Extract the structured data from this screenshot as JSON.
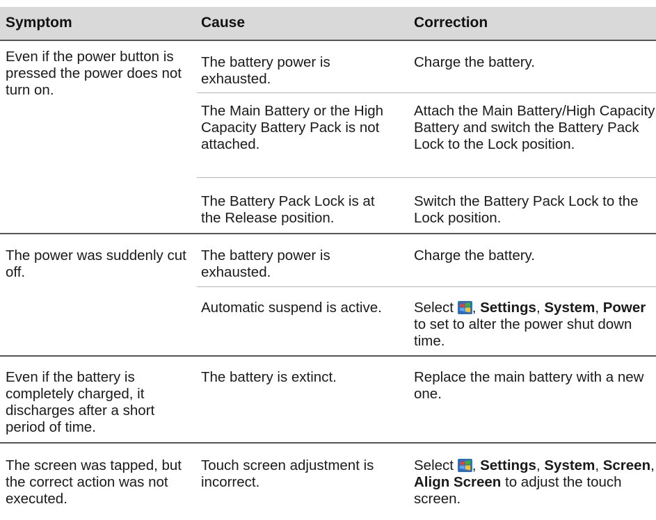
{
  "table": {
    "headers": {
      "symptom": "Symptom",
      "cause": "Cause",
      "correction": "Correction"
    },
    "groups": [
      {
        "symptom": "Even if the power button is pressed the power does not turn on.",
        "rows": [
          {
            "cause": "The battery power is exhausted.",
            "correction": "Charge the battery."
          },
          {
            "cause": "The Main Battery or the High Capacity Battery Pack is not attached.",
            "correction": "Attach the Main Battery/High Capacity Battery and switch the Battery Pack Lock to the Lock position."
          },
          {
            "cause": "The Battery Pack Lock is at the Release position.",
            "correction": "Switch the Battery Pack Lock to the Lock position."
          }
        ]
      },
      {
        "symptom": "The power was suddenly cut off.",
        "rows": [
          {
            "cause": "The battery power is exhausted.",
            "correction": "Charge the battery."
          },
          {
            "cause": "Automatic suspend is active.",
            "correction": {
              "select": "Select",
              "icon": "windows-start-icon",
              "sep1": ",",
              "settings": "Settings",
              "sep2": ",",
              "system": "System",
              "sep3": ",",
              "power": "Power",
              "rest": "to set to alter the power shut down time."
            }
          }
        ]
      },
      {
        "symptom": "Even if the battery is completely charged, it discharges after a short period of time.",
        "rows": [
          {
            "cause": "The battery is extinct.",
            "correction": "Replace the main battery with a new one."
          }
        ]
      },
      {
        "symptom": "The screen was tapped, but the correct action was not executed.",
        "rows": [
          {
            "cause": "Touch screen adjustment is incorrect.",
            "correction": {
              "select": "Select",
              "icon": "windows-start-icon",
              "sep1": ",",
              "settings": "Settings",
              "sep2": ",",
              "system": "System",
              "sep3": ",",
              "screen": "Screen",
              "sep4": ",",
              "align": "Align Screen",
              "rest": "to adjust the touch screen."
            }
          }
        ]
      }
    ]
  },
  "colors": {
    "header_bg": "#d9d9d9",
    "rule_dark": "#555555",
    "rule_light": "#b5b5b5",
    "flag_red": "#e8402a",
    "flag_green": "#3cae3a",
    "flag_blue": "#2d7ed6",
    "flag_yellow": "#f4c22b"
  }
}
